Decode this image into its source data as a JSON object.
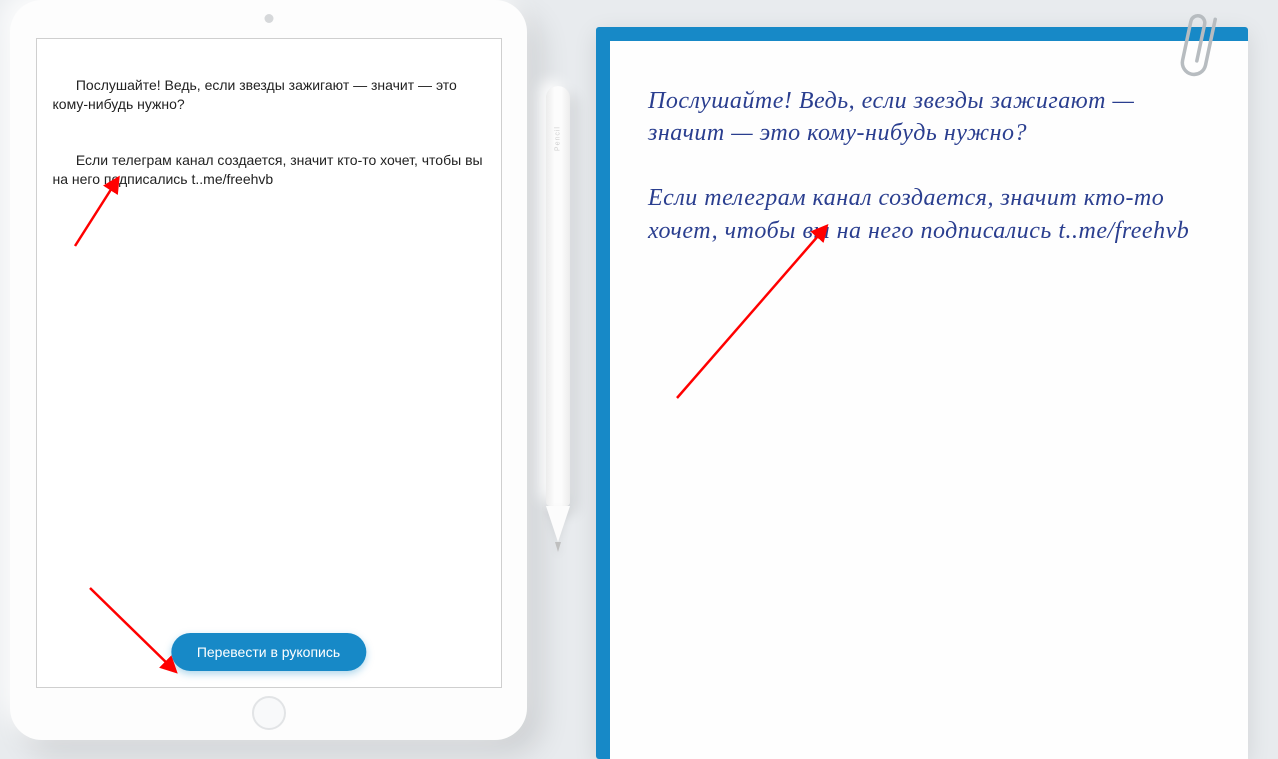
{
  "tablet": {
    "text_p1_a": "Послушайте! Ведь, если звезды зажигают — значит — это кому-нибудь нужно?",
    "text_p2_a": "Если ",
    "text_p2_spellerr": "телеграм",
    "text_p2_b": " канал создается, значит кто-то хочет, чтобы вы на него подписались t..me/freehvb",
    "button_label": "Перевести в рукопись"
  },
  "stylus": {
    "label": "Pencil"
  },
  "paper": {
    "hand_p1": "Послушайте! Ведь, если звезды зажигают — значит — это кому-нибудь нужно?",
    "hand_p2": "Если телеграм канал создается, значит кто-то хочет, чтобы вы на него подписались t..me/freehvb"
  },
  "colors": {
    "accent": "#1789c7",
    "ink": "#2a3e8f",
    "arrow": "#ff0000"
  }
}
